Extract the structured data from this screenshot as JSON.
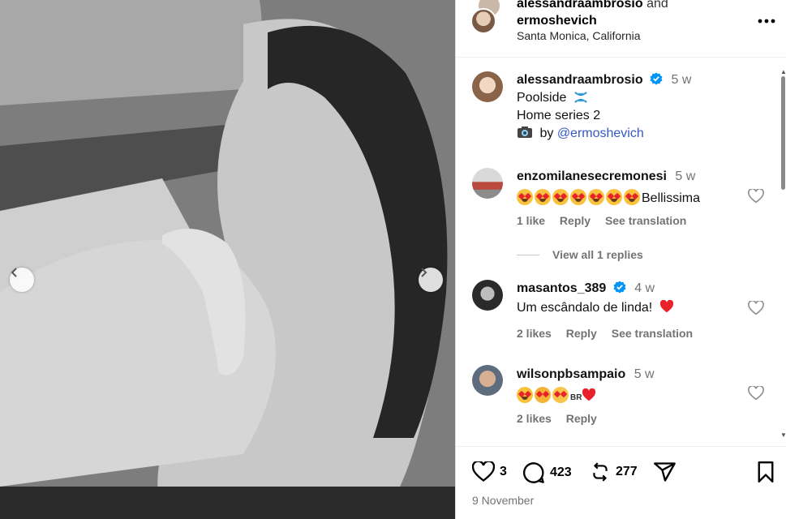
{
  "post": {
    "header": {
      "author_1": "alessandraambrosio",
      "and_word": "and",
      "author_2": "ermoshevich",
      "location": "Santa Monica, California",
      "more_icon": "more-horizontal-icon"
    },
    "caption": {
      "username": "alessandraambrosio",
      "verified": true,
      "time": "5 w",
      "line1": "Poolside",
      "line2": "Home series 2",
      "line3_prefix": "by",
      "line3_mention": "@ermoshevich"
    }
  },
  "comments": [
    {
      "username": "enzomilanesecremonesi",
      "time": "5 w",
      "text": "Bellissima",
      "emojis": 7,
      "likes": "1 like",
      "reply": "Reply",
      "translate": "See translation",
      "view_replies": "View all 1 replies"
    },
    {
      "username": "masantos_389",
      "verified": true,
      "time": "4 w",
      "text": "Um escândalo de linda!",
      "likes": "2 likes",
      "reply": "Reply",
      "translate": "See translation"
    },
    {
      "username": "wilsonpbsampaio",
      "time": "5 w",
      "flag_text": "BR",
      "likes": "2 likes",
      "reply": "Reply"
    }
  ],
  "actions": {
    "likes": "3",
    "comments": "423",
    "reposts": "277"
  },
  "date": "9 November",
  "colors": {
    "verified": "#0095f6",
    "heart_red": "#e8212b",
    "muted": "#737373"
  }
}
